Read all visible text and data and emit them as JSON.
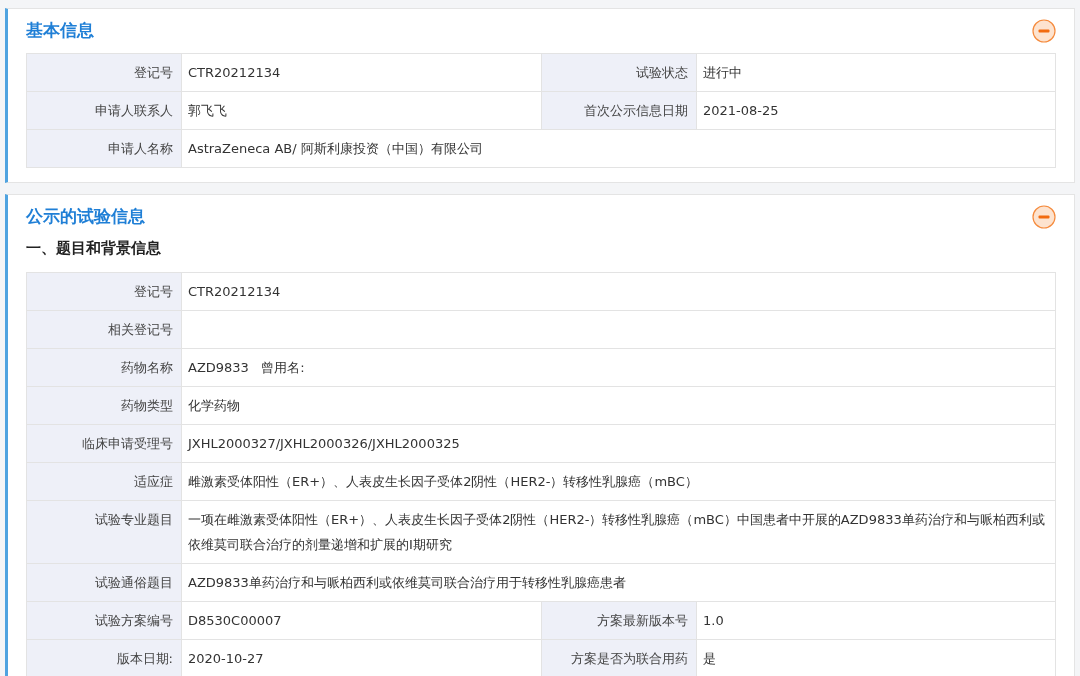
{
  "sections": [
    {
      "title": "基本信息",
      "expanded": true,
      "rows": [
        [
          {
            "label": "登记号",
            "value": "CTR20212134"
          },
          {
            "label": "试验状态",
            "value": "进行中"
          }
        ],
        [
          {
            "label": "申请人联系人",
            "value": "郭飞飞"
          },
          {
            "label": "首次公示信息日期",
            "value": "2021-08-25"
          }
        ],
        [
          {
            "label": "申请人名称",
            "value": "AstraZeneca AB/ 阿斯利康投资（中国）有限公司"
          }
        ]
      ]
    },
    {
      "title": "公示的试验信息",
      "expanded": true,
      "subtitle": "一、题目和背景信息",
      "rows": [
        [
          {
            "label": "登记号",
            "value": "CTR20212134"
          }
        ],
        [
          {
            "label": "相关登记号"
          }
        ],
        [
          {
            "label": "药物名称",
            "value": "AZD9833   曾用名:"
          }
        ],
        [
          {
            "label": "药物类型",
            "value": "化学药物"
          }
        ],
        [
          {
            "label": "临床申请受理号",
            "value": "JXHL2000327/JXHL2000326/JXHL2000325"
          }
        ],
        [
          {
            "label": "适应症",
            "value": "雌激素受体阳性（ER+）、人表皮生长因子受体2阴性（HER2-）转移性乳腺癌（mBC）"
          }
        ],
        [
          {
            "label": "试验专业题目",
            "value": "一项在雌激素受体阳性（ER+）、人表皮生长因子受体2阴性（HER2-）转移性乳腺癌（mBC）中国患者中开展的AZD9833单药治疗和与哌柏西利或依维莫司联合治疗的剂量递增和扩展的I期研究"
          }
        ],
        [
          {
            "label": "试验通俗题目",
            "value": "AZD9833单药治疗和与哌柏西利或依维莫司联合治疗用于转移性乳腺癌患者"
          }
        ],
        [
          {
            "label": "试验方案编号",
            "value": "D8530C00007"
          },
          {
            "label": "方案最新版本号",
            "value": "1.0"
          }
        ],
        [
          {
            "label": "版本日期:",
            "value": "2020-10-27"
          },
          {
            "label": "方案是否为联合用药",
            "value": "是"
          }
        ]
      ]
    }
  ]
}
